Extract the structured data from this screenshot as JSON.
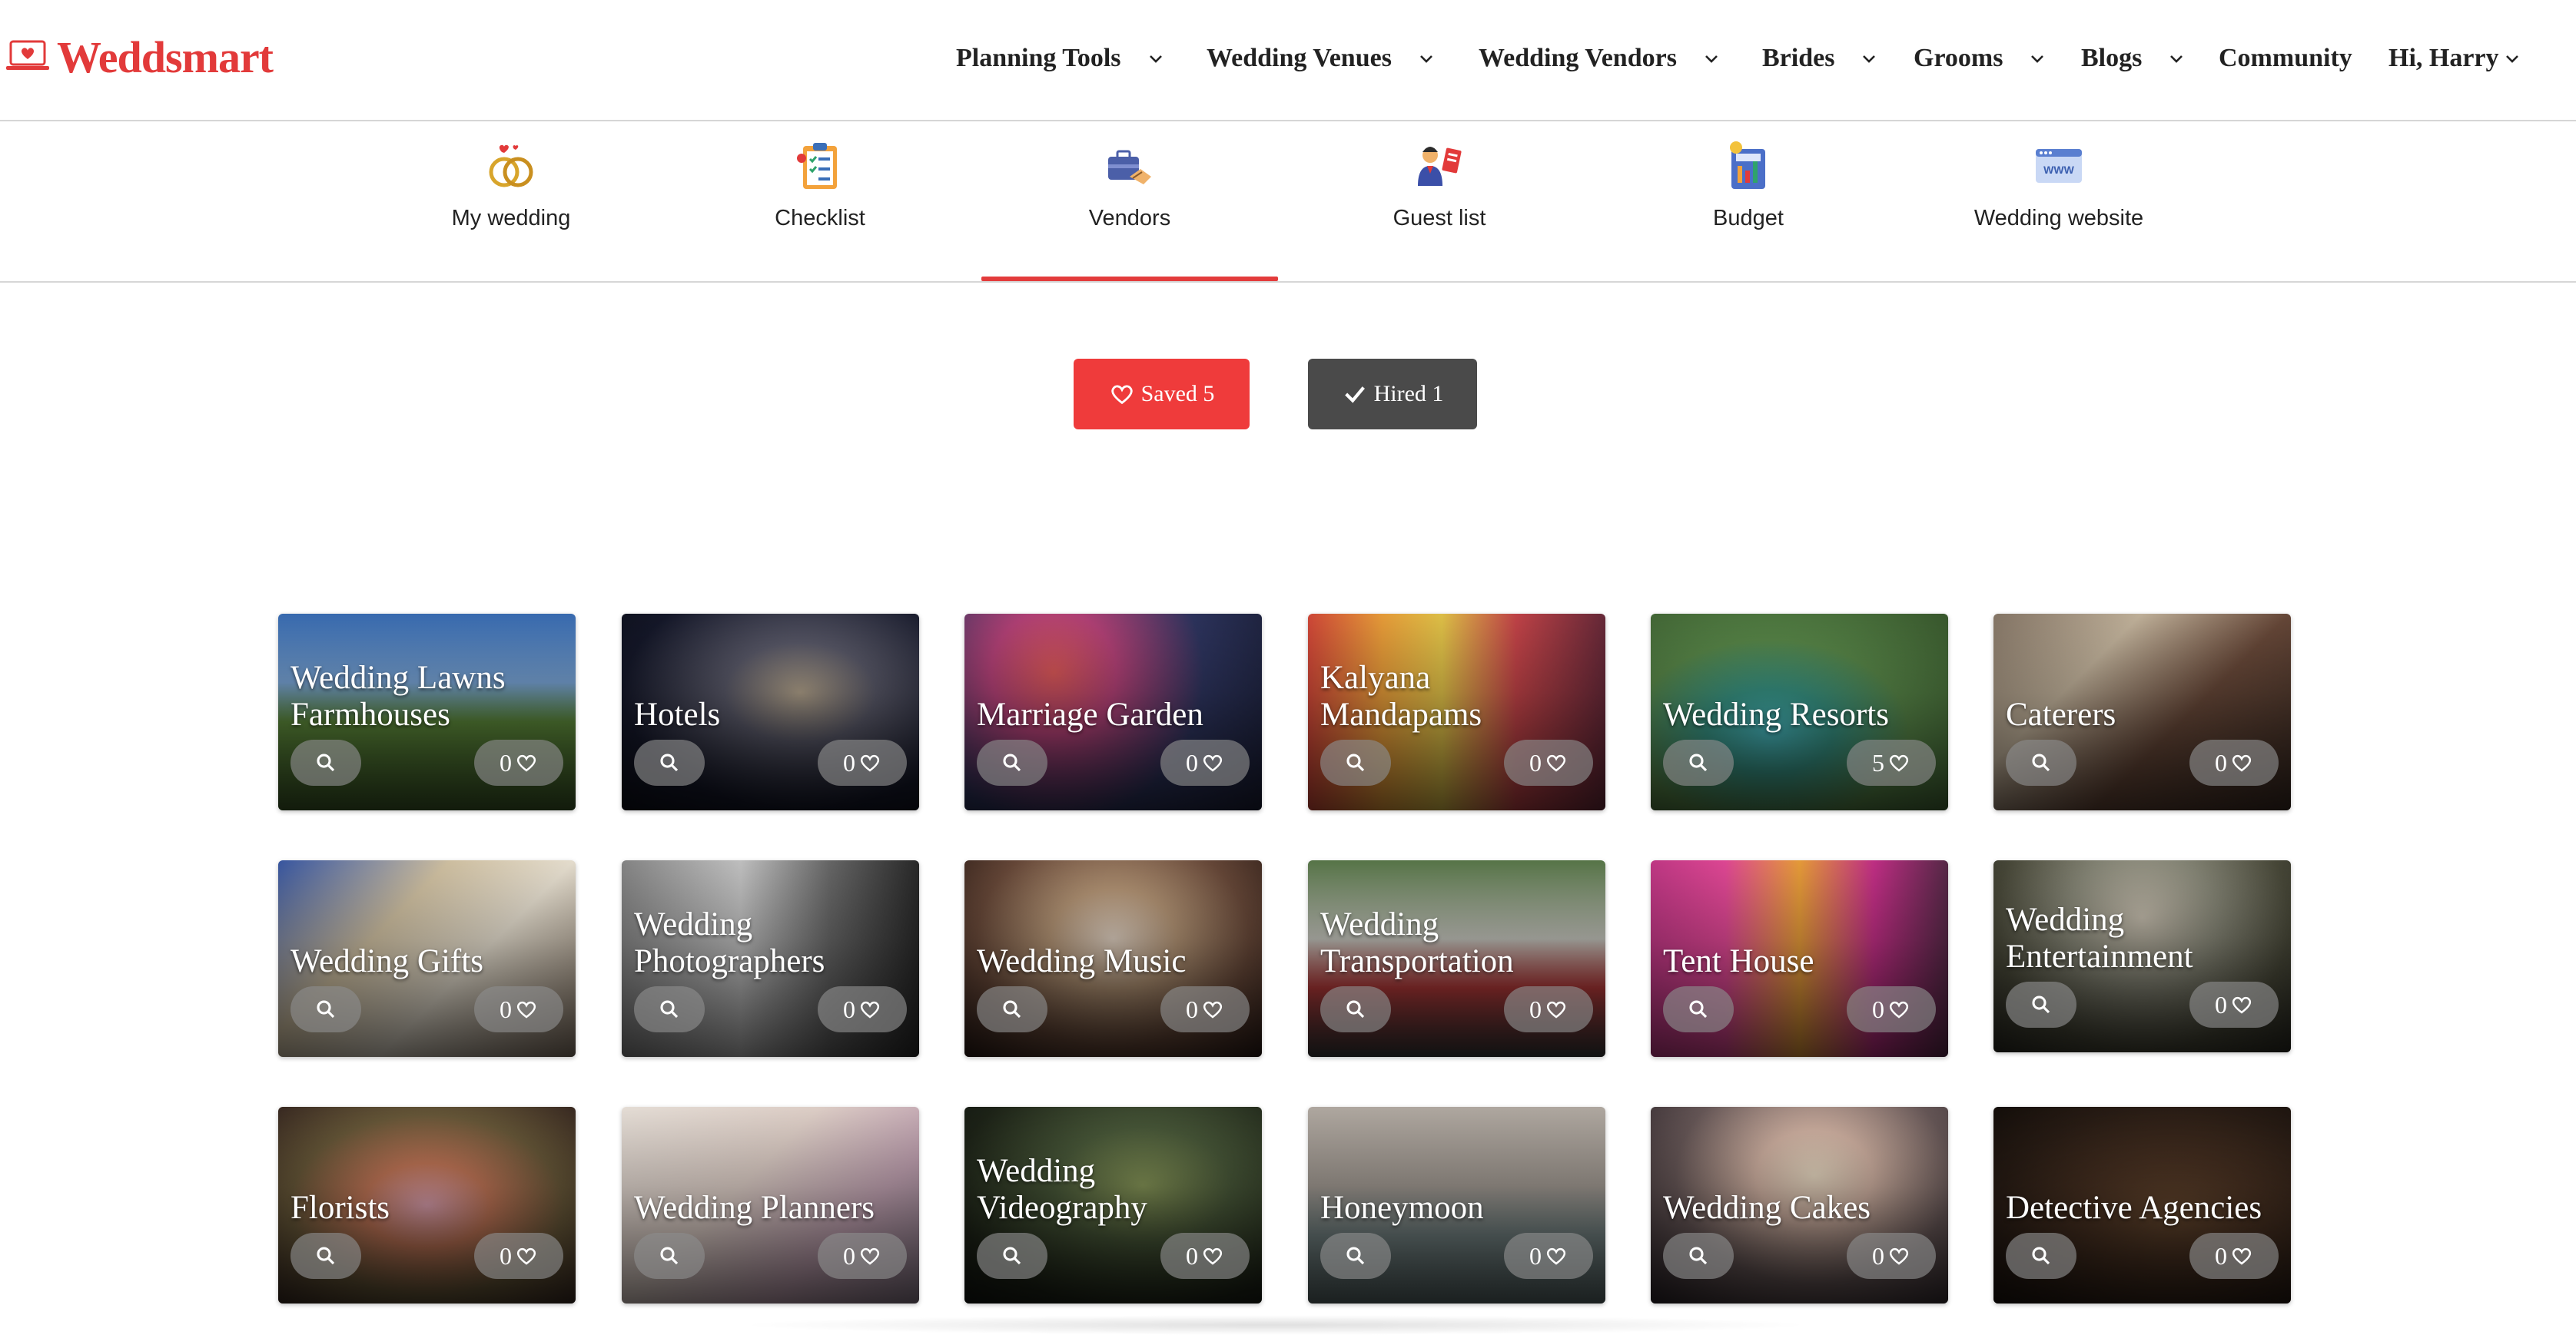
{
  "brand": {
    "name": "Weddsmart",
    "color": "#e23a3a"
  },
  "nav": {
    "items": [
      {
        "label": "Planning Tools",
        "has_dropdown": true
      },
      {
        "label": "Wedding Venues",
        "has_dropdown": true
      },
      {
        "label": "Wedding Vendors",
        "has_dropdown": true
      },
      {
        "label": "Brides",
        "has_dropdown": true
      },
      {
        "label": "Grooms",
        "has_dropdown": true
      },
      {
        "label": "Blogs",
        "has_dropdown": true
      },
      {
        "label": "Community",
        "has_dropdown": false
      },
      {
        "label": "Hi, Harry",
        "has_dropdown": true
      }
    ]
  },
  "tabs": [
    {
      "label": "My wedding",
      "icon": "rings-icon",
      "active": false
    },
    {
      "label": "Checklist",
      "icon": "clipboard-checklist-icon",
      "active": false
    },
    {
      "label": "Vendors",
      "icon": "vendors-handshake-icon",
      "active": true
    },
    {
      "label": "Guest list",
      "icon": "guest-list-icon",
      "active": false
    },
    {
      "label": "Budget",
      "icon": "budget-calculator-icon",
      "active": false
    },
    {
      "label": "Wedding website",
      "icon": "website-www-icon",
      "active": false
    }
  ],
  "filters": {
    "saved": {
      "label": "Saved 5",
      "icon": "heart-icon",
      "color": "#ef3b3b"
    },
    "hired": {
      "label": "Hired 1",
      "icon": "check-icon",
      "color": "#4a4a4a"
    }
  },
  "vendor_categories": [
    {
      "title": "Wedding Lawns Farmhouses",
      "saves": "0"
    },
    {
      "title": "Hotels",
      "saves": "0"
    },
    {
      "title": "Marriage Garden",
      "saves": "0"
    },
    {
      "title": "Kalyana Mandapams",
      "saves": "0"
    },
    {
      "title": "Wedding Resorts",
      "saves": "5"
    },
    {
      "title": "Caterers",
      "saves": "0"
    },
    {
      "title": "Wedding Gifts",
      "saves": "0"
    },
    {
      "title": "Wedding Photographers",
      "saves": "0"
    },
    {
      "title": "Wedding Music",
      "saves": "0"
    },
    {
      "title": "Wedding Transportation",
      "saves": "0"
    },
    {
      "title": "Tent House",
      "saves": "0"
    },
    {
      "title": "Wedding Entertainment",
      "saves": "0"
    },
    {
      "title": "Florists",
      "saves": "0"
    },
    {
      "title": "Wedding Planners",
      "saves": "0"
    },
    {
      "title": "Wedding Videography",
      "saves": "0"
    },
    {
      "title": "Honeymoon",
      "saves": "0"
    },
    {
      "title": "Wedding Cakes",
      "saves": "0"
    },
    {
      "title": "Detective Agencies",
      "saves": "0"
    }
  ]
}
